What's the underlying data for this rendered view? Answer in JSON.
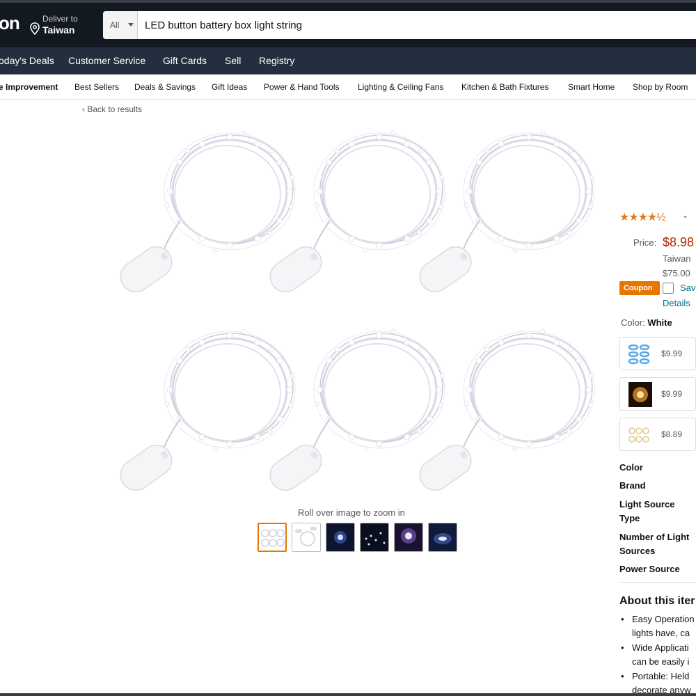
{
  "header": {
    "logo_fragment": "on",
    "deliver_label": "Deliver to",
    "deliver_location": "Taiwan",
    "search_dept": "All",
    "search_value": "LED button battery box light string"
  },
  "nav": [
    "oday's Deals",
    "Customer Service",
    "Gift Cards",
    "Sell",
    "Registry"
  ],
  "subnav": [
    "e Improvement",
    "Best Sellers",
    "Deals & Savings",
    "Gift Ideas",
    "Power & Hand Tools",
    "Lighting & Ceiling Fans",
    "Kitchen & Bath Fixtures",
    "Smart Home",
    "Shop by Room"
  ],
  "back_link": "‹ Back to results",
  "zoom_hint": "Roll over image to zoom in",
  "thumbnails": 6,
  "product": {
    "rating_stars": "★★★★½",
    "rating_value": 4.5,
    "price_label": "Price:",
    "price": "$8.98",
    "shipping_line1": "Taiwan",
    "shipping_line2": "$75.00",
    "coupon_label": "Coupon",
    "save_text": "Sav",
    "details_link": "Details",
    "color_label": "Color:",
    "color_value": "White",
    "swatches": [
      {
        "price": "$9.99",
        "tint": "#5aa9e6"
      },
      {
        "price": "$9.99",
        "tint": "#f0a030"
      },
      {
        "price": "$8.89",
        "tint": "#e0c890"
      }
    ],
    "specs": [
      "Color",
      "Brand",
      "Light Source\nType",
      "Number of Light\nSources",
      "Power Source"
    ],
    "about_title": "About this iter",
    "bullets": [
      "Easy Operation\nlights have, ca",
      "Wide Applicati\ncan be easily i",
      "Portable: Held\ndecorate anyw"
    ]
  }
}
